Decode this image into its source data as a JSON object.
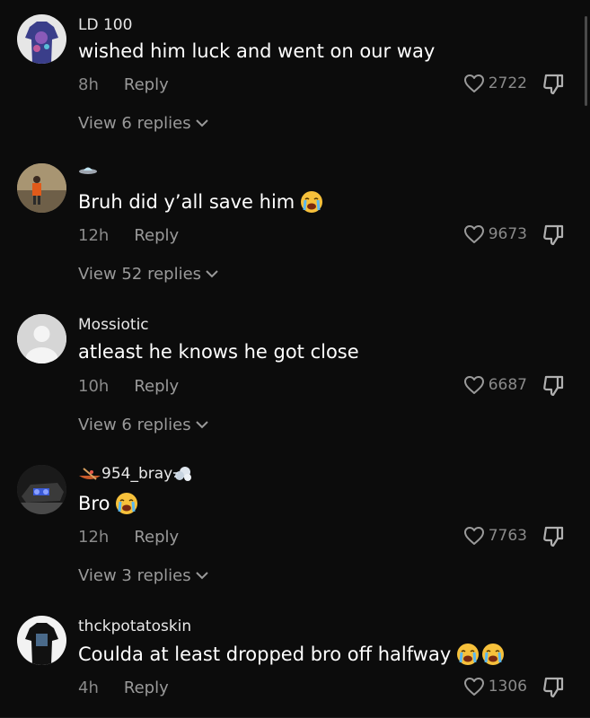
{
  "comments": [
    {
      "username": "LD 100",
      "text": "wished him luck and went on our way",
      "time": "8h",
      "reply": "Reply",
      "likes": "2722",
      "view_replies": "View 6 replies",
      "avatar": "avatar-shirt-photo"
    },
    {
      "username": "🛸",
      "text": "Bruh did y’all save him",
      "time": "12h",
      "reply": "Reply",
      "likes": "9673",
      "view_replies": "View 52 replies",
      "avatar": "avatar-person-photo",
      "emoji": [
        "loudly-crying-face"
      ]
    },
    {
      "username": "Mossiotic",
      "text": "atleast he knows he got close",
      "time": "10h",
      "reply": "Reply",
      "likes": "6687",
      "view_replies": "View 6 replies",
      "avatar": "default-avatar"
    },
    {
      "username": "954_bray",
      "text": "Bro",
      "time": "12h",
      "reply": "Reply",
      "likes": "7763",
      "view_replies": "View 3 replies",
      "avatar": "avatar-car-photo",
      "username_icons": [
        "canoe-icon",
        "dash-icon"
      ],
      "emoji": [
        "loudly-crying-face"
      ]
    },
    {
      "username": "thckpotatoskin",
      "text": "Coulda at least dropped bro off halfway",
      "time": "4h",
      "reply": "Reply",
      "likes": "1306",
      "avatar": "avatar-shirt-photo",
      "emoji": [
        "loudly-crying-face",
        "loudly-crying-face"
      ]
    }
  ],
  "colors": {
    "background": "#0c0c0c",
    "primary_text": "#ffffff",
    "secondary_text": "#8a8a8a"
  }
}
